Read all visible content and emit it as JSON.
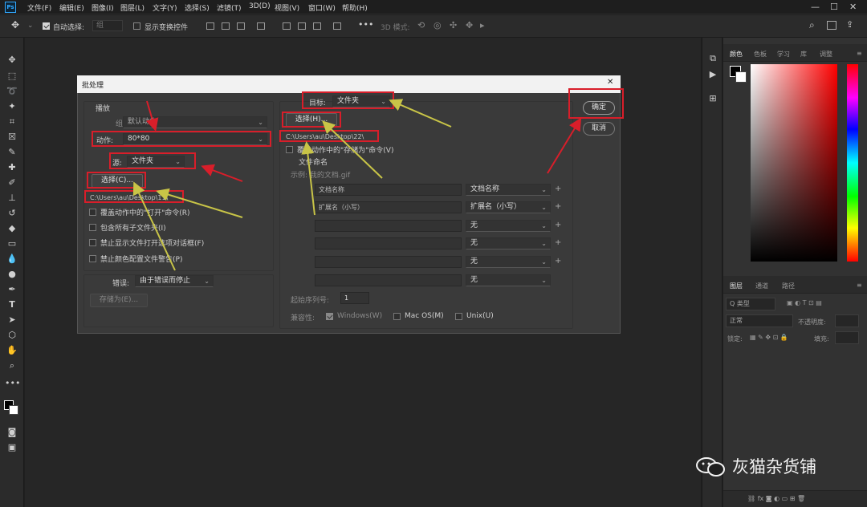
{
  "menu": {
    "logo": "Ps",
    "items": [
      "文件(F)",
      "编辑(E)",
      "图像(I)",
      "图层(L)",
      "文字(Y)",
      "选择(S)",
      "滤镜(T)",
      "3D(D)",
      "视图(V)",
      "窗口(W)",
      "帮助(H)"
    ],
    "window_min": "—",
    "window_max": "☐",
    "window_close": "✕"
  },
  "options": {
    "auto_select_label": "自动选择:",
    "auto_select_value": "组",
    "show_transform_label": "显示变换控件",
    "mode_3d_label": "3D 模式:"
  },
  "right_panel": {
    "color_tabs": [
      "颜色",
      "色板",
      "学习",
      "库",
      "调整"
    ],
    "layer_tabs": [
      "图层",
      "通道",
      "路径"
    ],
    "layer_filter": "Q 类型",
    "blend_mode": "正常",
    "opacity_label": "不透明度:",
    "lock_label": "锁定:",
    "fill_label": "填充:"
  },
  "dialog": {
    "title": "批处理",
    "close": "✕",
    "play_section": "播放",
    "group_label": "组:",
    "group_value": "默认动作",
    "action_label": "动作:",
    "action_value": "80*80",
    "source_label": "源:",
    "source_value": "文件夹",
    "choose_source_btn": "选择(C)...",
    "source_path": "C:\\Users\\au\\Desktop\\11\\",
    "source_options": [
      "覆盖动作中的\"打开\"命令(R)",
      "包含所有子文件夹(I)",
      "禁止显示文件打开选项对话框(F)",
      "禁止颜色配置文件警告(P)"
    ],
    "error_label": "错误:",
    "error_value": "由于错误而停止",
    "save_as_btn": "存储为(E)...",
    "target_label": "目标:",
    "target_value": "文件夹",
    "choose_target_btn": "选择(H)...",
    "target_path": "C:\\Users\\au\\Desktop\\22\\",
    "override_save": "覆盖动作中的\"存储为\"命令(V)",
    "naming_section": "文件命名",
    "example": "示例: 我的文档.gif",
    "naming_rows": [
      {
        "field": "文档名称",
        "select": "文档名称"
      },
      {
        "field": "扩展名（小写）",
        "select": "扩展名（小写）"
      },
      {
        "field": "",
        "select": "无"
      },
      {
        "field": "",
        "select": "无"
      },
      {
        "field": "",
        "select": "无"
      },
      {
        "field": "",
        "select": "无"
      }
    ],
    "plus": "+",
    "start_serial_label": "起始序列号:",
    "start_serial_value": "1",
    "compat_label": "兼容性:",
    "compat_options": [
      "Windows(W)",
      "Mac OS(M)",
      "Unix(U)"
    ],
    "ok_btn": "确定",
    "cancel_btn": "取消"
  },
  "watermark": "灰猫杂货铺",
  "colors": {
    "highlight": "#d81e2a",
    "arrow_red": "#d81e2a",
    "arrow_yellow": "#c8c447"
  }
}
